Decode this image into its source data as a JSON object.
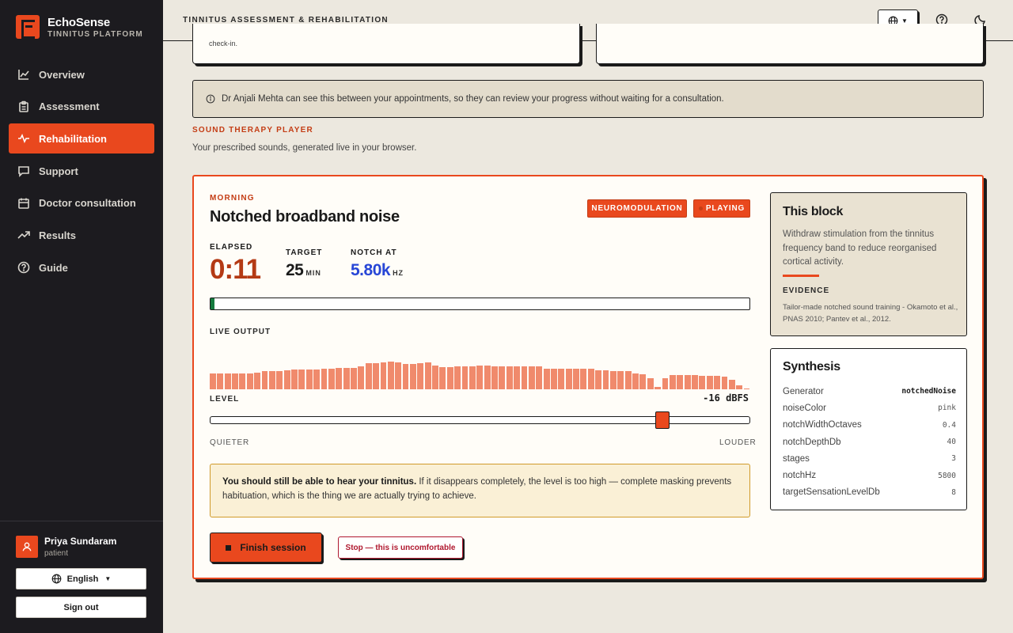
{
  "brand": {
    "name": "EchoSense",
    "subtitle": "TINNITUS PLATFORM"
  },
  "nav": [
    {
      "label": "Overview",
      "icon": "chart-line-icon",
      "active": false
    },
    {
      "label": "Assessment",
      "icon": "clipboard-icon",
      "active": false
    },
    {
      "label": "Rehabilitation",
      "icon": "pulse-icon",
      "active": true
    },
    {
      "label": "Support",
      "icon": "chat-bubble-icon",
      "active": false
    },
    {
      "label": "Doctor consultation",
      "icon": "calendar-icon",
      "active": false
    },
    {
      "label": "Results",
      "icon": "trending-up-icon",
      "active": false
    },
    {
      "label": "Guide",
      "icon": "help-circle-icon",
      "active": false
    }
  ],
  "user": {
    "name": "Priya Sundaram",
    "role": "patient"
  },
  "sidebar_buttons": {
    "language": "English",
    "signout": "Sign out"
  },
  "topbar": {
    "title": "TINNITUS ASSESSMENT & REHABILITATION"
  },
  "partial_card_text": "check-in.",
  "notice": "Dr Anjali Mehta can see this between your appointments, so they can review your progress without waiting for a consultation.",
  "section": {
    "title": "SOUND THERAPY PLAYER",
    "subtitle": "Your prescribed sounds, generated live in your browser."
  },
  "player": {
    "slot": "MORNING",
    "title": "Notched broadband noise",
    "badges": {
      "type": "NEUROMODULATION",
      "state": "PLAYING"
    },
    "elapsed_label": "ELAPSED",
    "elapsed": "0:11",
    "target_label": "TARGET",
    "target_value": "25",
    "target_unit": "MIN",
    "notch_label": "NOTCH AT",
    "notch_value": "5.80k",
    "notch_unit": "HZ",
    "progress_fraction": 0.007,
    "live_label": "LIVE OUTPUT",
    "level_label": "LEVEL",
    "level_value": "-16",
    "level_unit": "dBFS",
    "level_fraction": 0.84,
    "quieter": "QUIETER",
    "louder": "LOUDER",
    "warning_bold": "You should still be able to hear your tinnitus.",
    "warning_text": " If it disappears completely, the level is too high — complete masking prevents habituation, which is the thing we are actually trying to achieve.",
    "finish_label": "Finish session",
    "stop_label": "Stop — this is uncomfortable",
    "spectrum": [
      0.42,
      0.42,
      0.42,
      0.42,
      0.42,
      0.42,
      0.44,
      0.48,
      0.48,
      0.48,
      0.5,
      0.53,
      0.53,
      0.53,
      0.53,
      0.55,
      0.55,
      0.57,
      0.57,
      0.57,
      0.6,
      0.68,
      0.68,
      0.7,
      0.72,
      0.7,
      0.67,
      0.67,
      0.68,
      0.7,
      0.63,
      0.58,
      0.58,
      0.6,
      0.6,
      0.6,
      0.63,
      0.63,
      0.6,
      0.6,
      0.6,
      0.6,
      0.6,
      0.6,
      0.6,
      0.55,
      0.55,
      0.55,
      0.55,
      0.55,
      0.55,
      0.55,
      0.5,
      0.5,
      0.48,
      0.48,
      0.48,
      0.42,
      0.4,
      0.3,
      0.06,
      0.3,
      0.37,
      0.37,
      0.37,
      0.37,
      0.35,
      0.35,
      0.35,
      0.33,
      0.25,
      0.1,
      0.03
    ]
  },
  "info_card": {
    "title": "This block",
    "body": "Withdraw stimulation from the tinnitus frequency band to reduce reorganised cortical activity.",
    "evidence_label": "EVIDENCE",
    "evidence": "Tailor-made notched sound training - Okamoto et al., PNAS 2010; Pantev et al., 2012."
  },
  "synthesis": {
    "title": "Synthesis",
    "rows": [
      {
        "key": "Generator",
        "value": "notchedNoise"
      },
      {
        "key": "noiseColor",
        "value": "pink"
      },
      {
        "key": "notchWidthOctaves",
        "value": "0.4"
      },
      {
        "key": "notchDepthDb",
        "value": "40"
      },
      {
        "key": "stages",
        "value": "3"
      },
      {
        "key": "notchHz",
        "value": "5800"
      },
      {
        "key": "targetSensationLevelDb",
        "value": "8"
      }
    ]
  },
  "colors": {
    "accent": "#e9481e",
    "sidebar": "#1c1b1f",
    "background": "#ece8df",
    "progress": "#157a3e",
    "notch_value": "#2746d6",
    "elapsed": "#b43a15"
  }
}
